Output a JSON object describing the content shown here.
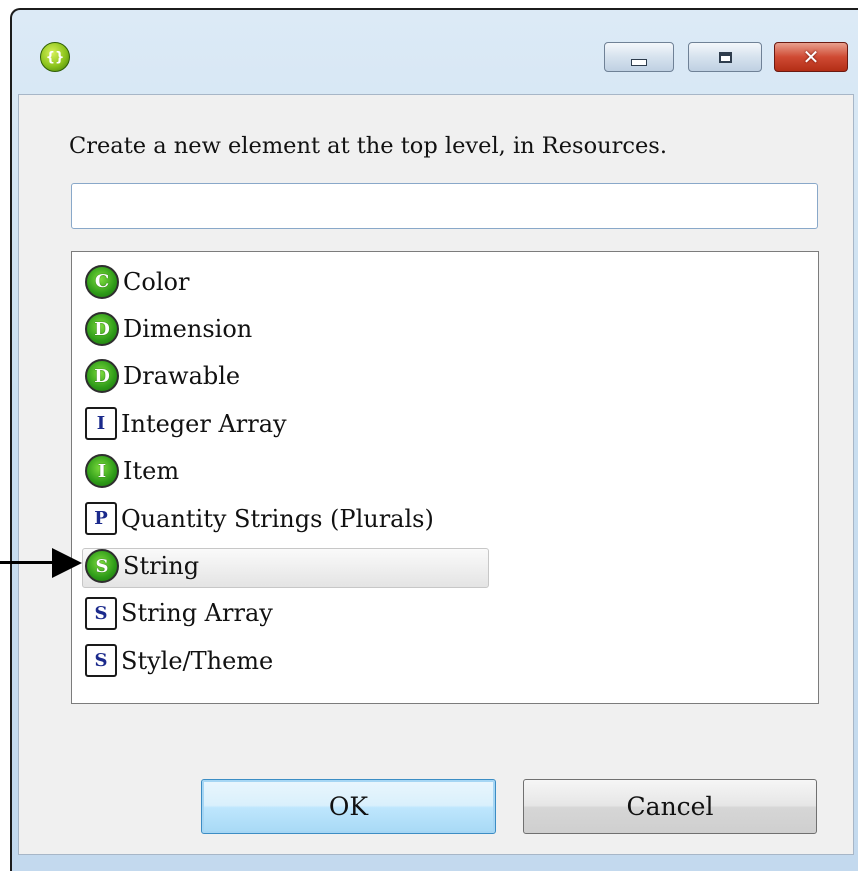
{
  "window": {
    "app_icon_glyph": "{}",
    "minimize_icon": "minimize-icon",
    "maximize_icon": "maximize-icon",
    "close_glyph": "✕"
  },
  "dialog": {
    "message": "Create a new element at the top level, in Resources.",
    "filter_value": "",
    "items": [
      {
        "icon": "color-icon",
        "shape": "circle",
        "glyph": "C",
        "label": "Color",
        "selected": false
      },
      {
        "icon": "dimension-icon",
        "shape": "circle",
        "glyph": "D",
        "label": "Dimension",
        "selected": false
      },
      {
        "icon": "drawable-icon",
        "shape": "circle",
        "glyph": "D",
        "label": "Drawable",
        "selected": false
      },
      {
        "icon": "integer-array-icon",
        "shape": "square",
        "glyph": "I",
        "label": "Integer Array",
        "selected": false
      },
      {
        "icon": "item-icon",
        "shape": "circle",
        "glyph": "I",
        "label": "Item",
        "selected": false
      },
      {
        "icon": "plurals-icon",
        "shape": "square",
        "glyph": "P",
        "label": "Quantity Strings (Plurals)",
        "selected": false
      },
      {
        "icon": "string-icon",
        "shape": "circle",
        "glyph": "S",
        "label": "String",
        "selected": true
      },
      {
        "icon": "string-array-icon",
        "shape": "square",
        "glyph": "S",
        "label": "String Array",
        "selected": false
      },
      {
        "icon": "style-theme-icon",
        "shape": "square",
        "glyph": "S",
        "label": "Style/Theme",
        "selected": false
      }
    ],
    "ok_label": "OK",
    "cancel_label": "Cancel"
  },
  "colors": {
    "element_icon_green": "#2d9a18",
    "array_icon_blue": "#1b2a8c",
    "ok_button_highlight": "#bee6fd",
    "close_button_red": "#cf4a33"
  }
}
